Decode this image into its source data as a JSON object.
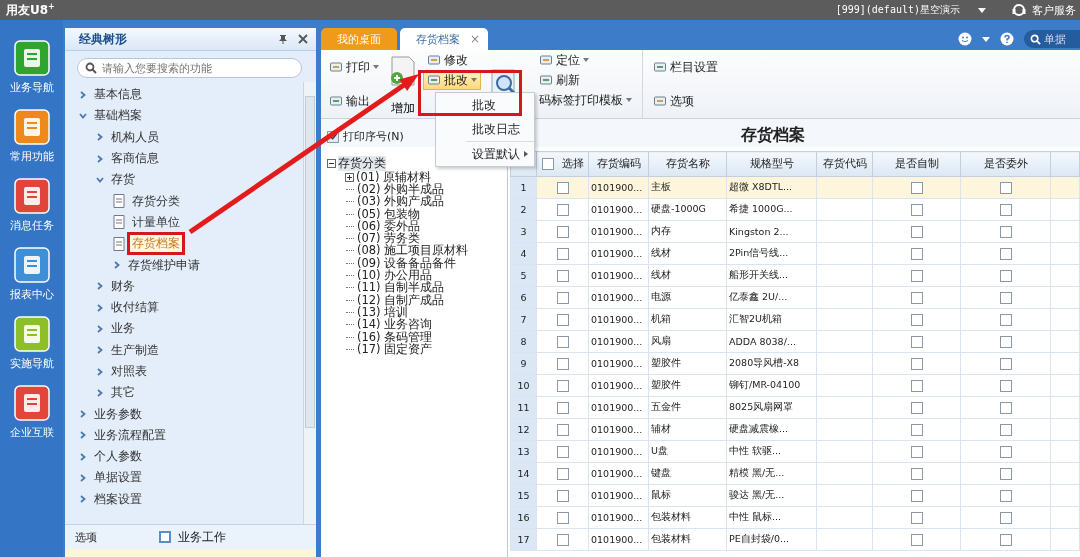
{
  "app_bar": {
    "logo": "用友U8",
    "logo_sup": "+",
    "account": "[999](default)星空演示",
    "service": "客户服务"
  },
  "rail": [
    {
      "label": "业务导航",
      "kind": "nav"
    },
    {
      "label": "常用功能",
      "kind": "star"
    },
    {
      "label": "消息任务",
      "kind": "message"
    },
    {
      "label": "报表中心",
      "kind": "report"
    },
    {
      "label": "实施导航",
      "kind": "compass"
    },
    {
      "label": "企业互联",
      "kind": "connect"
    }
  ],
  "nav_panel": {
    "title": "经典树形",
    "search": {
      "placeholder": "请输入您要搜索的功能"
    },
    "tree": [
      {
        "label": "基本信息",
        "kind": "folder",
        "expanded": false,
        "selected": false
      },
      {
        "label": "基础档案",
        "kind": "folder",
        "expanded": true,
        "selected": false,
        "children": [
          {
            "label": "机构人员",
            "kind": "folder",
            "expanded": false,
            "selected": false
          },
          {
            "label": "客商信息",
            "kind": "folder",
            "expanded": false,
            "selected": false
          },
          {
            "label": "存货",
            "kind": "folder",
            "expanded": true,
            "selected": false,
            "children": [
              {
                "label": "存货分类",
                "kind": "leaf",
                "selected": false
              },
              {
                "label": "计量单位",
                "kind": "leaf",
                "selected": false
              },
              {
                "label": "存货档案",
                "kind": "leaf",
                "selected": true
              },
              {
                "label": "存货维护申请",
                "kind": "folder",
                "expanded": false,
                "selected": false
              }
            ]
          },
          {
            "label": "财务",
            "kind": "folder",
            "expanded": false,
            "selected": false
          },
          {
            "label": "收付结算",
            "kind": "folder",
            "expanded": false,
            "selected": false
          },
          {
            "label": "业务",
            "kind": "folder",
            "expanded": false,
            "selected": false
          },
          {
            "label": "生产制造",
            "kind": "folder",
            "expanded": false,
            "selected": false
          },
          {
            "label": "对照表",
            "kind": "folder",
            "expanded": false,
            "selected": false
          },
          {
            "label": "其它",
            "kind": "folder",
            "expanded": false,
            "selected": false
          }
        ]
      },
      {
        "label": "业务参数",
        "kind": "folder",
        "expanded": false,
        "selected": false
      },
      {
        "label": "业务流程配置",
        "kind": "folder",
        "expanded": false,
        "selected": false
      },
      {
        "label": "个人参数",
        "kind": "folder",
        "expanded": false,
        "selected": false
      },
      {
        "label": "单据设置",
        "kind": "folder",
        "expanded": false,
        "selected": false
      },
      {
        "label": "档案设置",
        "kind": "folder",
        "expanded": false,
        "selected": false
      }
    ],
    "footer": {
      "options": "选项",
      "workspace": "业务工作"
    }
  },
  "tabs": [
    {
      "label": "我的桌面",
      "selected": false
    },
    {
      "label": "存货档案",
      "selected": true,
      "close": "×"
    }
  ],
  "top_search": {
    "placeholder": "单据"
  },
  "toolbar": [
    {
      "kind": "pair",
      "items": [
        {
          "label": "打印",
          "menu": true,
          "highlighted": false
        },
        {
          "label": "输出",
          "menu": false,
          "highlighted": false
        }
      ]
    },
    {
      "kind": "large",
      "items": [
        {
          "label": "增加"
        }
      ]
    },
    {
      "kind": "stack",
      "items": [
        {
          "label": "修改",
          "menu": false,
          "highlighted": false
        },
        {
          "label": "批改",
          "menu": true,
          "highlighted": true
        }
      ]
    },
    {
      "kind": "search"
    },
    {
      "kind": "stack",
      "items": [
        {
          "label": "定位",
          "menu": true,
          "highlighted": false
        },
        {
          "label": "刷新",
          "menu": false,
          "highlighted": false
        },
        {
          "label": "码标签打印模板",
          "menu": true,
          "highlighted": false
        }
      ]
    },
    {
      "kind": "pair",
      "items": [
        {
          "label": "栏目设置",
          "menu": false,
          "highlighted": false
        },
        {
          "label": "选项",
          "menu": false,
          "highlighted": false
        }
      ]
    }
  ],
  "dropdown": [
    {
      "label": "批改",
      "submenu": false
    },
    {
      "label": "批改日志",
      "submenu": false
    },
    {
      "label": "设置默认",
      "submenu": true
    }
  ],
  "print_row_number": {
    "label": "打印序号(N)",
    "checked": true
  },
  "category_tree": {
    "label": "存货分类",
    "expanded": true,
    "selected": true,
    "children": [
      {
        "label": "(01) 原辅材料",
        "has_children": true,
        "selected": false
      },
      {
        "label": "(02) 外购半成品",
        "has_children": false,
        "selected": false
      },
      {
        "label": "(03) 外购产成品",
        "has_children": false,
        "selected": false
      },
      {
        "label": "(05) 包装物",
        "has_children": false,
        "selected": false
      },
      {
        "label": "(06) 委外品",
        "has_children": false,
        "selected": false
      },
      {
        "label": "(07) 劳务类",
        "has_children": false,
        "selected": false
      },
      {
        "label": "(08) 施工项目原材料",
        "has_children": false,
        "selected": false
      },
      {
        "label": "(09) 设备备品备件",
        "has_children": false,
        "selected": false
      },
      {
        "label": "(10) 办公用品",
        "has_children": false,
        "selected": false
      },
      {
        "label": "(11) 自制半成品",
        "has_children": false,
        "selected": false
      },
      {
        "label": "(12) 自制产成品",
        "has_children": false,
        "selected": false
      },
      {
        "label": "(13) 培训",
        "has_children": false,
        "selected": false
      },
      {
        "label": "(14) 业务咨询",
        "has_children": false,
        "selected": false
      },
      {
        "label": "(16) 条码管理",
        "has_children": false,
        "selected": false
      },
      {
        "label": "(17) 固定资产",
        "has_children": false,
        "selected": false
      }
    ]
  },
  "table": {
    "title": "存货档案",
    "select_all_checked": false,
    "columns": [
      "选择",
      "存货编码",
      "存货名称",
      "规格型号",
      "存货代码",
      "是否自制",
      "是否委外"
    ],
    "rows": [
      {
        "num": "1",
        "checked": false,
        "code": "0101900...",
        "name": "主板",
        "spec": "超微 X8DTL...",
        "self_made": false,
        "outsourced": false,
        "selected": true
      },
      {
        "num": "2",
        "checked": false,
        "code": "0101900...",
        "name": "硬盘-1000G",
        "spec": "希捷 1000G...",
        "self_made": false,
        "outsourced": false,
        "selected": false
      },
      {
        "num": "3",
        "checked": false,
        "code": "0101900...",
        "name": "内存",
        "spec": "Kingston 2...",
        "self_made": false,
        "outsourced": false,
        "selected": false
      },
      {
        "num": "4",
        "checked": false,
        "code": "0101900...",
        "name": "线材",
        "spec": "2Pin信号线...",
        "self_made": false,
        "outsourced": false,
        "selected": false
      },
      {
        "num": "5",
        "checked": false,
        "code": "0101900...",
        "name": "线材",
        "spec": "船形开关线...",
        "self_made": false,
        "outsourced": false,
        "selected": false
      },
      {
        "num": "6",
        "checked": false,
        "code": "0101900...",
        "name": "电源",
        "spec": "亿泰鑫 2U/...",
        "self_made": false,
        "outsourced": false,
        "selected": false
      },
      {
        "num": "7",
        "checked": false,
        "code": "0101900...",
        "name": "机箱",
        "spec": "汇智2U机箱",
        "self_made": false,
        "outsourced": false,
        "selected": false
      },
      {
        "num": "8",
        "checked": false,
        "code": "0101900...",
        "name": "风扇",
        "spec": "ADDA 8038/...",
        "self_made": false,
        "outsourced": false,
        "selected": false
      },
      {
        "num": "9",
        "checked": false,
        "code": "0101900...",
        "name": "塑胶件",
        "spec": "2080导风槽-X8",
        "self_made": false,
        "outsourced": false,
        "selected": false
      },
      {
        "num": "10",
        "checked": false,
        "code": "0101900...",
        "name": "塑胶件",
        "spec": "铆钉/MR-04100",
        "self_made": false,
        "outsourced": false,
        "selected": false
      },
      {
        "num": "11",
        "checked": false,
        "code": "0101900...",
        "name": "五金件",
        "spec": "8025风扇网罩",
        "self_made": false,
        "outsourced": false,
        "selected": false
      },
      {
        "num": "12",
        "checked": false,
        "code": "0101900...",
        "name": "辅材",
        "spec": "硬盘减震橡...",
        "self_made": false,
        "outsourced": false,
        "selected": false
      },
      {
        "num": "13",
        "checked": false,
        "code": "0101900...",
        "name": "U盘",
        "spec": "中性 软驱...",
        "self_made": false,
        "outsourced": false,
        "selected": false
      },
      {
        "num": "14",
        "checked": false,
        "code": "0101900...",
        "name": "键盘",
        "spec": "精模 黑/无...",
        "self_made": false,
        "outsourced": false,
        "selected": false
      },
      {
        "num": "15",
        "checked": false,
        "code": "0101900...",
        "name": "鼠标",
        "spec": "骏达 黑/无...",
        "self_made": false,
        "outsourced": false,
        "selected": false
      },
      {
        "num": "16",
        "checked": false,
        "code": "0101900...",
        "name": "包装材料",
        "spec": "中性 鼠标...",
        "self_made": false,
        "outsourced": false,
        "selected": false
      },
      {
        "num": "17",
        "checked": false,
        "code": "0101900...",
        "name": "包装材料",
        "spec": "PE自封袋/0...",
        "self_made": false,
        "outsourced": false,
        "selected": false
      }
    ]
  }
}
